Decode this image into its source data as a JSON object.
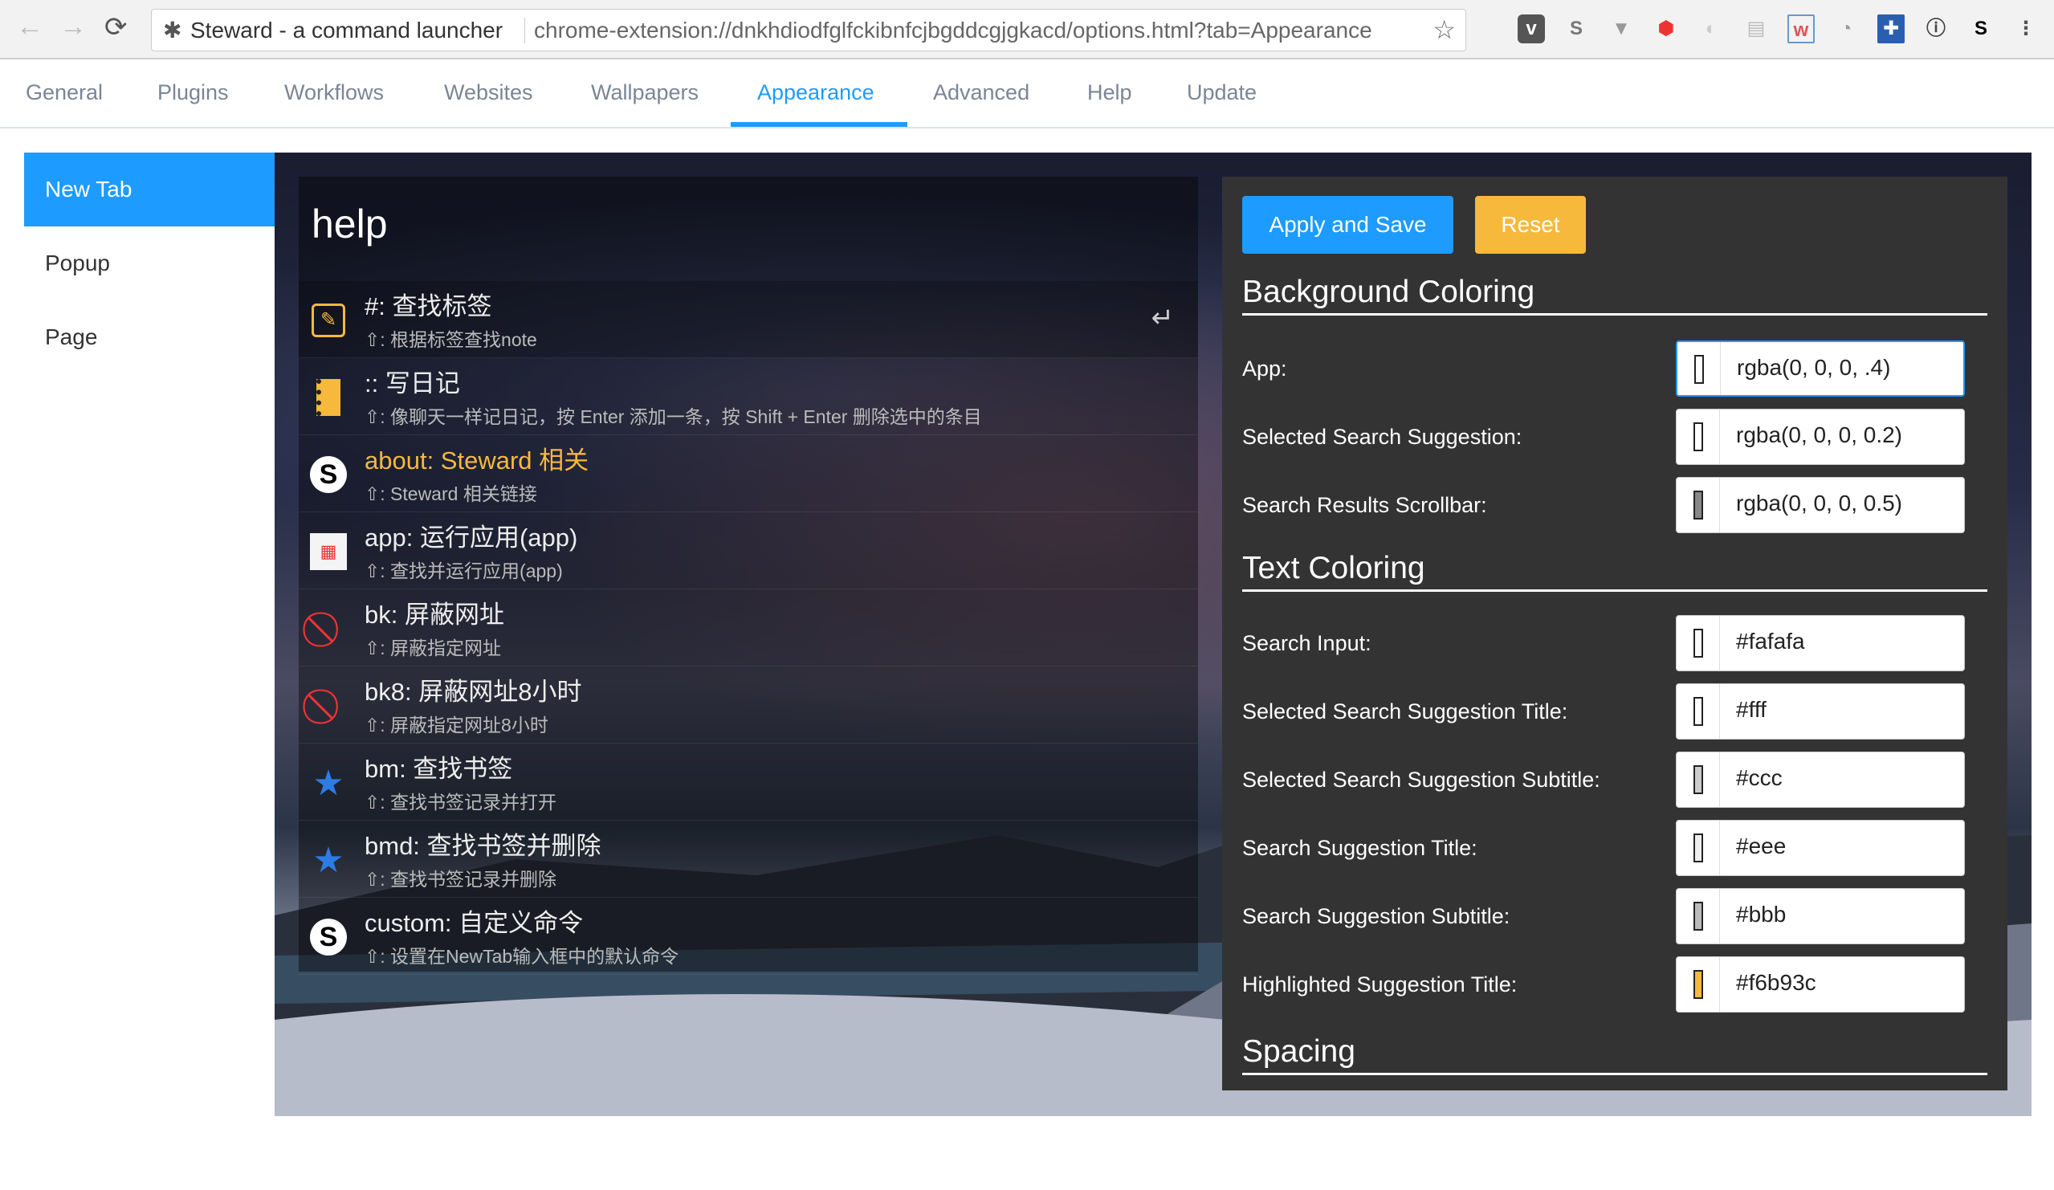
{
  "browser": {
    "page_title": "Steward - a command launcher",
    "url": "chrome-extension://dnkhdiodfglfckibnfcjbgddcgjgkacd/options.html?tab=Appearance"
  },
  "tabs": [
    {
      "label": "General"
    },
    {
      "label": "Plugins"
    },
    {
      "label": "Workflows"
    },
    {
      "label": "Websites"
    },
    {
      "label": "Wallpapers"
    },
    {
      "label": "Appearance",
      "active": true
    },
    {
      "label": "Advanced"
    },
    {
      "label": "Help"
    },
    {
      "label": "Update"
    }
  ],
  "sidebar": {
    "items": [
      {
        "label": "New Tab",
        "active": true
      },
      {
        "label": "Popup"
      },
      {
        "label": "Page"
      }
    ]
  },
  "preview": {
    "query": "help",
    "results": [
      {
        "icon": "tag-note-icon",
        "title": "#: 查找标签",
        "subtitle": "⇧: 根据标签查找note",
        "selected": true
      },
      {
        "icon": "diary-icon",
        "title": ":: 写日记",
        "subtitle": "⇧: 像聊天一样记日记，按 Enter 添加一条，按 Shift + Enter 删除选中的条目"
      },
      {
        "icon": "steward-logo-icon",
        "title": "about: Steward 相关",
        "subtitle": "⇧: Steward 相关链接",
        "highlighted": true
      },
      {
        "icon": "apps-grid-icon",
        "title": "app: 运行应用(app)",
        "subtitle": "⇧: 查找并运行应用(app)"
      },
      {
        "icon": "block-icon",
        "title": "bk: 屏蔽网址",
        "subtitle": "⇧: 屏蔽指定网址"
      },
      {
        "icon": "block-icon",
        "title": "bk8: 屏蔽网址8小时",
        "subtitle": "⇧: 屏蔽指定网址8小时"
      },
      {
        "icon": "star-icon",
        "title": "bm: 查找书签",
        "subtitle": "⇧: 查找书签记录并打开"
      },
      {
        "icon": "star-icon",
        "title": "bmd: 查找书签并删除",
        "subtitle": "⇧: 查找书签记录并删除"
      },
      {
        "icon": "steward-logo-icon",
        "title": "custom: 自定义命令",
        "subtitle": "⇧: 设置在NewTab输入框中的默认命令"
      }
    ]
  },
  "settings": {
    "apply_label": "Apply and Save",
    "reset_label": "Reset",
    "background_heading": "Background Coloring",
    "background": [
      {
        "label": "App:",
        "value": "rgba(0, 0, 0, .4)",
        "swatch": "#ffffff"
      },
      {
        "label": "Selected Search Suggestion:",
        "value": "rgba(0, 0, 0, 0.2)",
        "swatch": "#ffffff"
      },
      {
        "label": "Search Results Scrollbar:",
        "value": "rgba(0, 0, 0, 0.5)",
        "swatch": "#888888"
      }
    ],
    "text_heading": "Text Coloring",
    "text": [
      {
        "label": "Search Input:",
        "value": "#fafafa",
        "swatch": "#fafafa"
      },
      {
        "label": "Selected Search Suggestion Title:",
        "value": "#fff",
        "swatch": "#ffffff"
      },
      {
        "label": "Selected Search Suggestion Subtitle:",
        "value": "#ccc",
        "swatch": "#cccccc"
      },
      {
        "label": "Search Suggestion Title:",
        "value": "#eee",
        "swatch": "#eeeeee"
      },
      {
        "label": "Search Suggestion Subtitle:",
        "value": "#bbb",
        "swatch": "#bbbbbb"
      },
      {
        "label": "Highlighted Suggestion Title:",
        "value": "#f6b93c",
        "swatch": "#f6b93c"
      }
    ],
    "spacing_heading": "Spacing"
  },
  "colors": {
    "accent": "#1e9bff",
    "reset": "#f6b93c",
    "highlight": "#f6b93c"
  }
}
